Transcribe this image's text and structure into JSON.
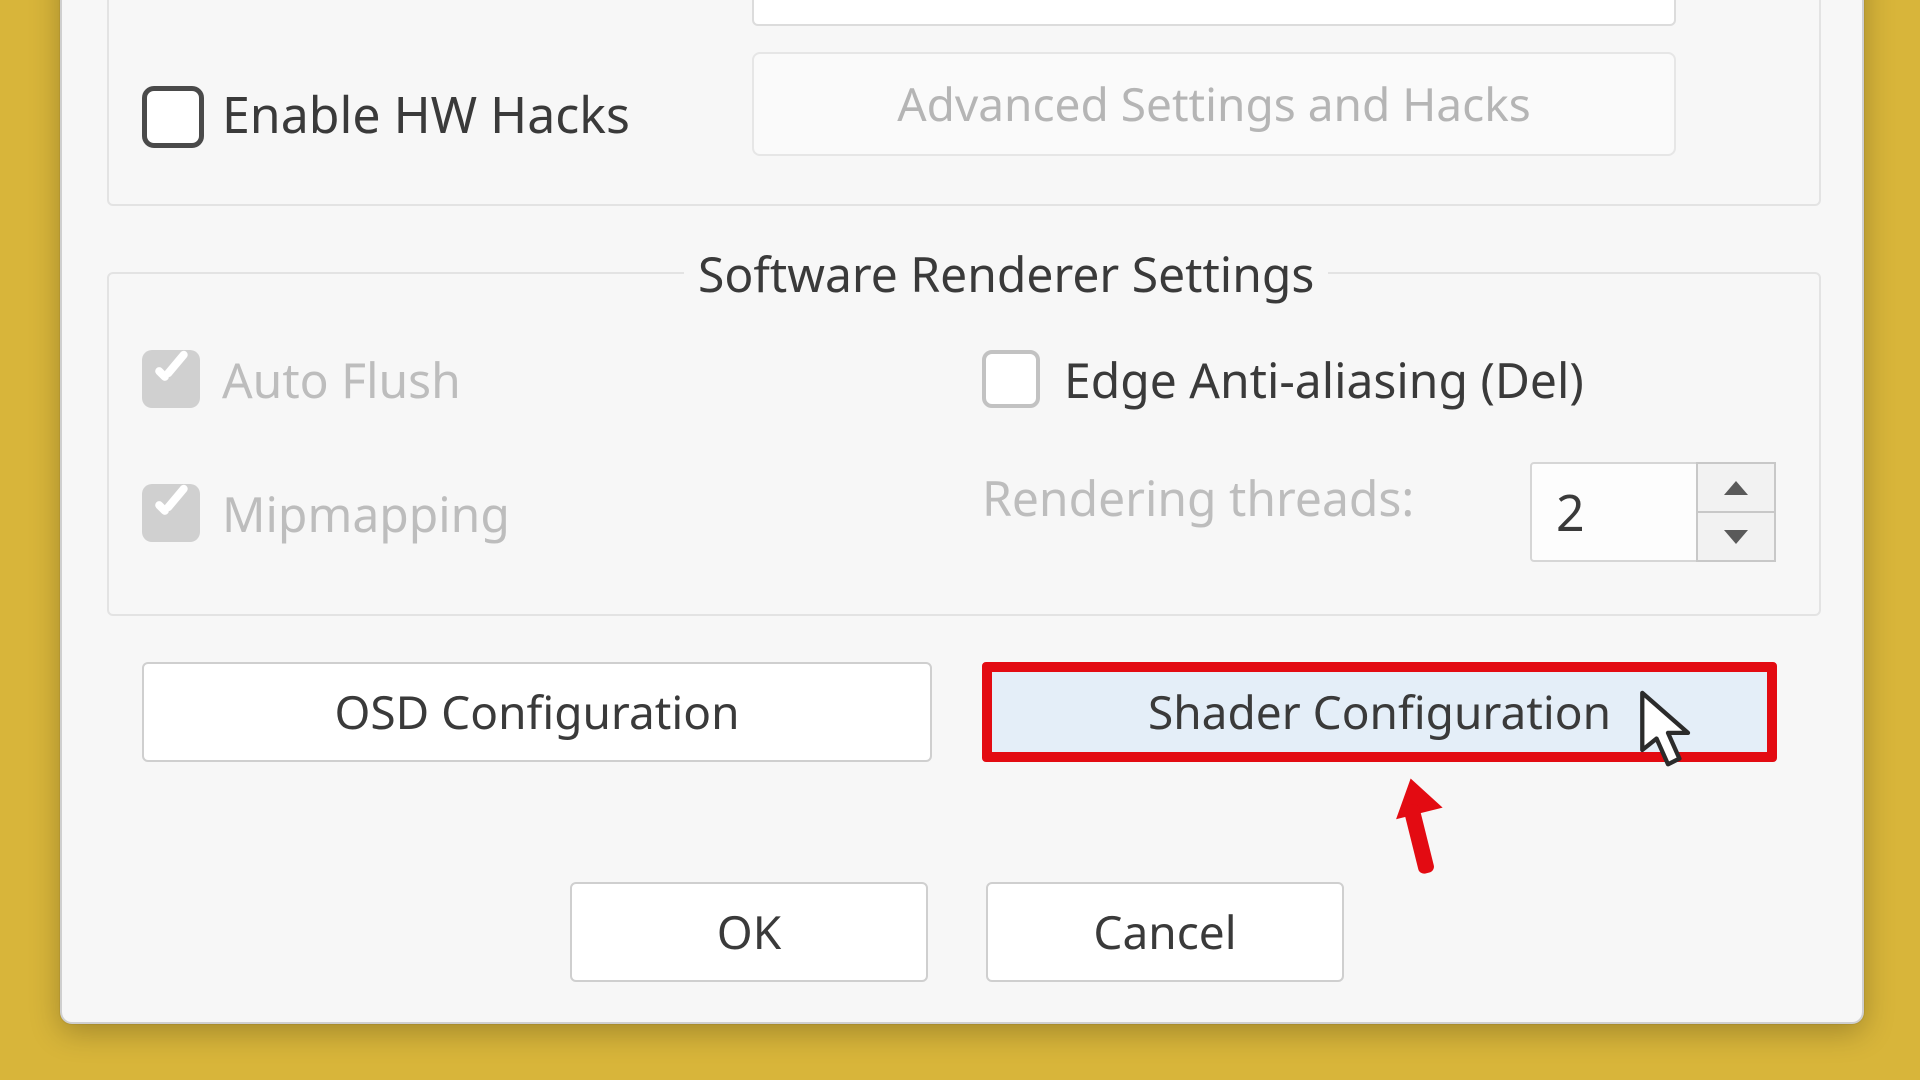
{
  "top_group": {
    "enable_hw_hacks_label": "Enable HW Hacks",
    "enable_hw_hacks_checked": false,
    "advanced_button_label": "Advanced Settings and Hacks"
  },
  "software_renderer": {
    "group_title": "Software Renderer Settings",
    "auto_flush": {
      "label": "Auto Flush",
      "checked": true,
      "enabled": false
    },
    "mipmapping": {
      "label": "Mipmapping",
      "checked": true,
      "enabled": false
    },
    "edge_aa": {
      "label": "Edge Anti-aliasing (Del)",
      "checked": false,
      "enabled": true
    },
    "rendering_threads_label": "Rendering threads:",
    "rendering_threads_value": "2"
  },
  "config_buttons": {
    "osd_label": "OSD Configuration",
    "shader_label": "Shader Configuration"
  },
  "dialog_buttons": {
    "ok_label": "OK",
    "cancel_label": "Cancel"
  },
  "annotation": {
    "highlight_target": "shader-config-button",
    "highlight_color": "#e30b12"
  }
}
